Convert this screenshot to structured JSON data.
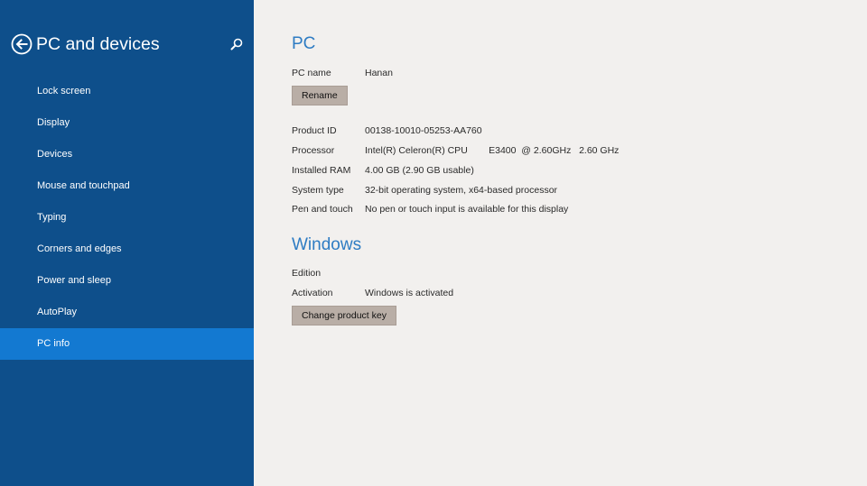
{
  "colors": {
    "sidebar_bg": "#0e4f8b",
    "sidebar_selected": "#1379d1",
    "content_bg": "#f2f0ee",
    "heading": "#2e7cc3",
    "button_bg": "#b9aea6"
  },
  "sidebar": {
    "back_icon": "back-arrow-circle-icon",
    "title": "PC and devices",
    "search_icon": "search-icon",
    "items": [
      {
        "label": "Lock screen"
      },
      {
        "label": "Display"
      },
      {
        "label": "Devices"
      },
      {
        "label": "Mouse and touchpad"
      },
      {
        "label": "Typing"
      },
      {
        "label": "Corners and edges"
      },
      {
        "label": "Power and sleep"
      },
      {
        "label": "AutoPlay"
      },
      {
        "label": "PC info",
        "selected": true
      }
    ]
  },
  "pc": {
    "heading": "PC",
    "pc_name_label": "PC name",
    "pc_name_value": "Hanan",
    "rename_button": "Rename",
    "rows": [
      {
        "label": "Product ID",
        "value": "00138-10010-05253-AA760"
      },
      {
        "label": "Processor",
        "value": "Intel(R) Celeron(R) CPU        E3400  @ 2.60GHz   2.60 GHz"
      },
      {
        "label": "Installed RAM",
        "value": "4.00 GB (2.90 GB usable)"
      },
      {
        "label": "System type",
        "value": "32-bit operating system, x64-based processor"
      },
      {
        "label": "Pen and touch",
        "value": "No pen or touch input is available for this display"
      }
    ]
  },
  "windows": {
    "heading": "Windows",
    "edition_label": "Edition",
    "edition_value": "",
    "activation_label": "Activation",
    "activation_value": "Windows is activated",
    "change_key_button": "Change product key"
  }
}
